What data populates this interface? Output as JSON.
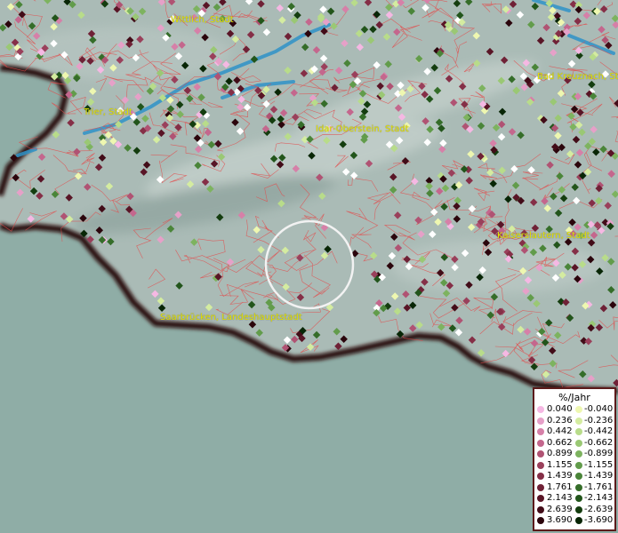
{
  "colors": {
    "sea": "#8fada6",
    "land": "#a9bab5",
    "border": "#e34b4b",
    "coast": "#3b0f0f",
    "water": "#2f93c8",
    "city_label": "#e6e600"
  },
  "cities": [
    {
      "name": "Wittlich, Stadt"
    },
    {
      "name": "Bad Kreuznach, St"
    },
    {
      "name": "Trier, Stadt"
    },
    {
      "name": "Idar-Oberstein, Stadt"
    },
    {
      "name": "Kaiserslautern, Stadt"
    },
    {
      "name": "Saarbrücken, Landeshauptstadt"
    }
  ],
  "legend": {
    "title": "%/Jahr",
    "positive": [
      {
        "label": "0.040",
        "color": "#f5b8e3"
      },
      {
        "label": "0.236",
        "color": "#e6a0c8"
      },
      {
        "label": "0.442",
        "color": "#d680a8"
      },
      {
        "label": "0.662",
        "color": "#c4678d"
      },
      {
        "label": "0.899",
        "color": "#b05373"
      },
      {
        "label": "1.155",
        "color": "#9a405b"
      },
      {
        "label": "1.439",
        "color": "#852f47"
      },
      {
        "label": "1.761",
        "color": "#6f2136"
      },
      {
        "label": "2.143",
        "color": "#591526"
      },
      {
        "label": "2.639",
        "color": "#420c18"
      },
      {
        "label": "3.690",
        "color": "#2b050c"
      }
    ],
    "negative": [
      {
        "label": "-0.040",
        "color": "#eef7b0"
      },
      {
        "label": "-0.236",
        "color": "#d4eca0"
      },
      {
        "label": "-0.442",
        "color": "#b8dc8a"
      },
      {
        "label": "-0.662",
        "color": "#9ac874"
      },
      {
        "label": "-0.899",
        "color": "#7db35f"
      },
      {
        "label": "-1.155",
        "color": "#629c4b"
      },
      {
        "label": "-1.439",
        "color": "#4a8539"
      },
      {
        "label": "-1.761",
        "color": "#356d29"
      },
      {
        "label": "-2.143",
        "color": "#22551b"
      },
      {
        "label": "-2.639",
        "color": "#143d0f"
      },
      {
        "label": "-3.690",
        "color": "#082606"
      }
    ]
  }
}
